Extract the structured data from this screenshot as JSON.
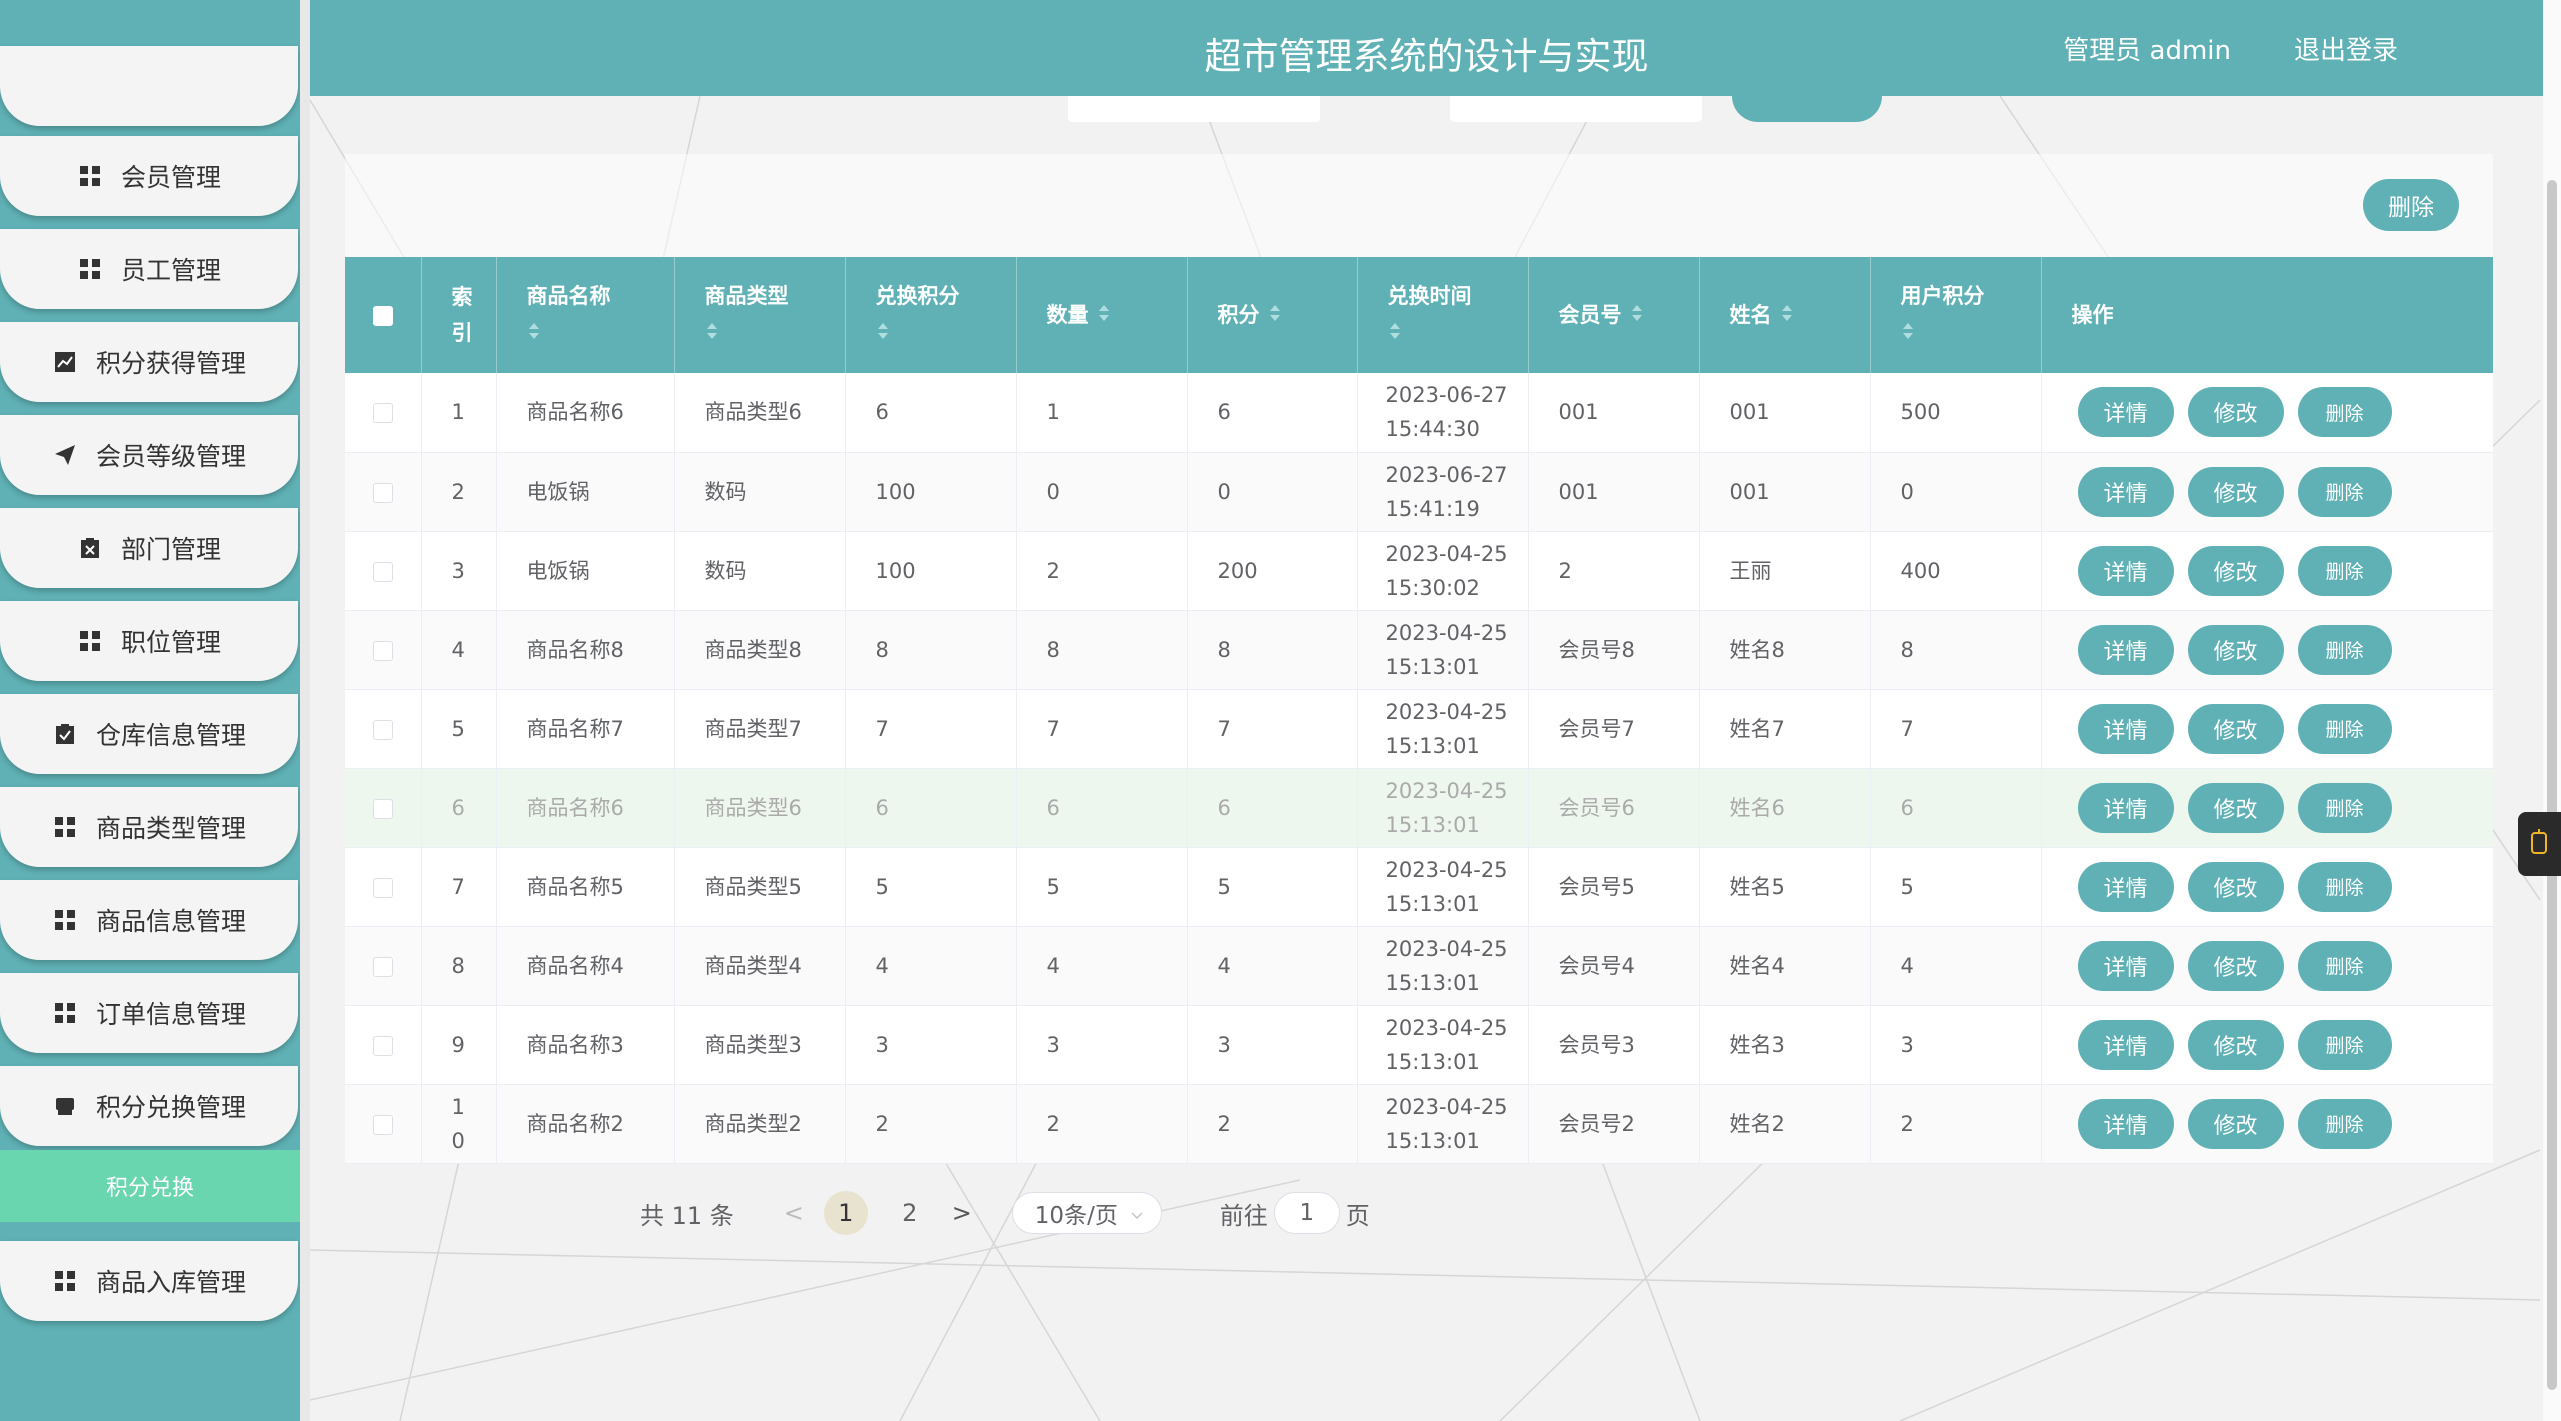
{
  "app_title": "超市管理系统的设计与实现",
  "header": {
    "user": "管理员 admin",
    "logout": "退出登录"
  },
  "sidebar": {
    "items": [
      {
        "label": "会员管理",
        "icon": "grid-icon"
      },
      {
        "label": "员工管理",
        "icon": "grid-icon"
      },
      {
        "label": "积分获得管理",
        "icon": "chart-icon"
      },
      {
        "label": "会员等级管理",
        "icon": "send-icon"
      },
      {
        "label": "部门管理",
        "icon": "clipboard-x-icon"
      },
      {
        "label": "职位管理",
        "icon": "grid-icon"
      },
      {
        "label": "仓库信息管理",
        "icon": "clipboard-check-icon"
      },
      {
        "label": "商品类型管理",
        "icon": "grid-icon"
      },
      {
        "label": "商品信息管理",
        "icon": "grid-icon"
      },
      {
        "label": "订单信息管理",
        "icon": "grid-icon"
      },
      {
        "label": "积分兑换管理",
        "icon": "box-icon"
      },
      {
        "label": "商品入库管理",
        "icon": "grid-icon"
      }
    ],
    "active_submenu": "积分兑换"
  },
  "toolbar": {
    "delete_label": "删除"
  },
  "table": {
    "headers": {
      "index": "索引",
      "name": "商品名称",
      "type": "商品类型",
      "points_cost": "兑换积分",
      "qty": "数量",
      "points": "积分",
      "time": "兑换时间",
      "member_no": "会员号",
      "member_name": "姓名",
      "user_points": "用户积分",
      "ops": "操作"
    },
    "actions": {
      "detail": "详情",
      "edit": "修改",
      "delete": "删除"
    },
    "rows": [
      {
        "index": "1",
        "name": "商品名称6",
        "type": "商品类型6",
        "points_cost": "6",
        "qty": "1",
        "points": "6",
        "time": "2023-06-27 15:44:30",
        "member_no": "001",
        "member_name": "001",
        "user_points": "500"
      },
      {
        "index": "2",
        "name": "电饭锅",
        "type": "数码",
        "points_cost": "100",
        "qty": "0",
        "points": "0",
        "time": "2023-06-27 15:41:19",
        "member_no": "001",
        "member_name": "001",
        "user_points": "0"
      },
      {
        "index": "3",
        "name": "电饭锅",
        "type": "数码",
        "points_cost": "100",
        "qty": "2",
        "points": "200",
        "time": "2023-04-25 15:30:02",
        "member_no": "2",
        "member_name": "王丽",
        "user_points": "400"
      },
      {
        "index": "4",
        "name": "商品名称8",
        "type": "商品类型8",
        "points_cost": "8",
        "qty": "8",
        "points": "8",
        "time": "2023-04-25 15:13:01",
        "member_no": "会员号8",
        "member_name": "姓名8",
        "user_points": "8"
      },
      {
        "index": "5",
        "name": "商品名称7",
        "type": "商品类型7",
        "points_cost": "7",
        "qty": "7",
        "points": "7",
        "time": "2023-04-25 15:13:01",
        "member_no": "会员号7",
        "member_name": "姓名7",
        "user_points": "7"
      },
      {
        "index": "6",
        "name": "商品名称6",
        "type": "商品类型6",
        "points_cost": "6",
        "qty": "6",
        "points": "6",
        "time": "2023-04-25 15:13:01",
        "member_no": "会员号6",
        "member_name": "姓名6",
        "user_points": "6"
      },
      {
        "index": "7",
        "name": "商品名称5",
        "type": "商品类型5",
        "points_cost": "5",
        "qty": "5",
        "points": "5",
        "time": "2023-04-25 15:13:01",
        "member_no": "会员号5",
        "member_name": "姓名5",
        "user_points": "5"
      },
      {
        "index": "8",
        "name": "商品名称4",
        "type": "商品类型4",
        "points_cost": "4",
        "qty": "4",
        "points": "4",
        "time": "2023-04-25 15:13:01",
        "member_no": "会员号4",
        "member_name": "姓名4",
        "user_points": "4"
      },
      {
        "index": "9",
        "name": "商品名称3",
        "type": "商品类型3",
        "points_cost": "3",
        "qty": "3",
        "points": "3",
        "time": "2023-04-25 15:13:01",
        "member_no": "会员号3",
        "member_name": "姓名3",
        "user_points": "3"
      },
      {
        "index": "10",
        "name": "商品名称2",
        "type": "商品类型2",
        "points_cost": "2",
        "qty": "2",
        "points": "2",
        "time": "2023-04-25 15:13:01",
        "member_no": "会员号2",
        "member_name": "姓名2",
        "user_points": "2"
      }
    ]
  },
  "pagination": {
    "total": "共 11 条",
    "prev": "<",
    "next": ">",
    "pages": [
      "1",
      "2"
    ],
    "current": "1",
    "page_size": "10条/页",
    "goto_label": "前往",
    "goto_value": "1",
    "page_unit": "页"
  },
  "colors": {
    "primary": "#5fb1b5",
    "submenu_active": "#6ad6b0"
  }
}
